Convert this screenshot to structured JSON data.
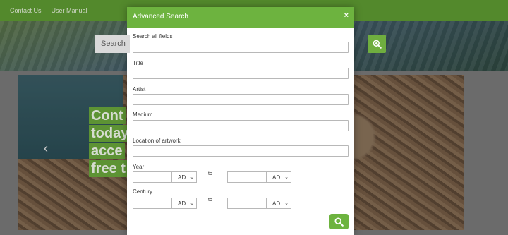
{
  "nav": {
    "contact": "Contact Us",
    "manual": "User Manual"
  },
  "hero": {
    "search_placeholder": "Search"
  },
  "slider": {
    "lines": [
      "Cont",
      "today",
      "acce",
      "free t"
    ],
    "prev": "‹"
  },
  "modal": {
    "title": "Advanced Search",
    "close": "×",
    "fields": {
      "all": "Search all fields",
      "title": "Title",
      "artist": "Artist",
      "medium": "Medium",
      "location": "Location of artwork",
      "year": "Year",
      "century": "Century"
    },
    "year": {
      "from_era": "AD",
      "to": "to",
      "to_era": "AD"
    },
    "century": {
      "from_era": "AD",
      "to": "to",
      "to_era": "AD"
    }
  },
  "colors": {
    "accent": "#6db33f",
    "nav": "#5f9c33"
  },
  "icons": {
    "search": "search-icon",
    "zoom": "zoom-in-icon",
    "close": "close-icon",
    "chevron": "chevron-down-icon"
  }
}
